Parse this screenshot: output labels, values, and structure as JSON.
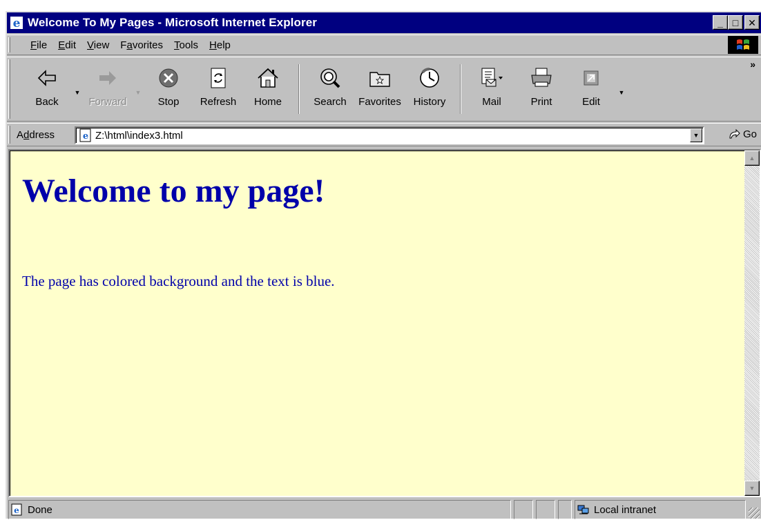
{
  "window": {
    "title": "Welcome To My Pages - Microsoft Internet Explorer",
    "controls": {
      "minimize": "_",
      "maximize": "□",
      "close": "✕"
    }
  },
  "menu": {
    "items": [
      {
        "label": "File",
        "accel": "F",
        "rest": "ile"
      },
      {
        "label": "Edit",
        "accel": "E",
        "rest": "dit"
      },
      {
        "label": "View",
        "accel": "V",
        "rest": "iew"
      },
      {
        "label": "Favorites",
        "pre": "F",
        "accel": "a",
        "rest": "vorites"
      },
      {
        "label": "Tools",
        "accel": "T",
        "rest": "ools"
      },
      {
        "label": "Help",
        "accel": "H",
        "rest": "elp"
      }
    ]
  },
  "toolbar": {
    "back": "Back",
    "forward": "Forward",
    "stop": "Stop",
    "refresh": "Refresh",
    "home": "Home",
    "search": "Search",
    "favorites": "Favorites",
    "history": "History",
    "mail": "Mail",
    "print": "Print",
    "edit": "Edit",
    "more": "»"
  },
  "address": {
    "label_pre": "A",
    "label_accel": "d",
    "label_rest": "dress",
    "value": "Z:\\html\\index3.html",
    "go": "Go"
  },
  "page": {
    "heading": "Welcome to my page!",
    "paragraph": "The page has colored background and the text is blue.",
    "background": "#ffffcc",
    "text_color": "#0000aa"
  },
  "status": {
    "text": "Done",
    "zone": "Local intranet"
  },
  "colors": {
    "titlebar": "#000080",
    "chrome": "#c0c0c0"
  }
}
